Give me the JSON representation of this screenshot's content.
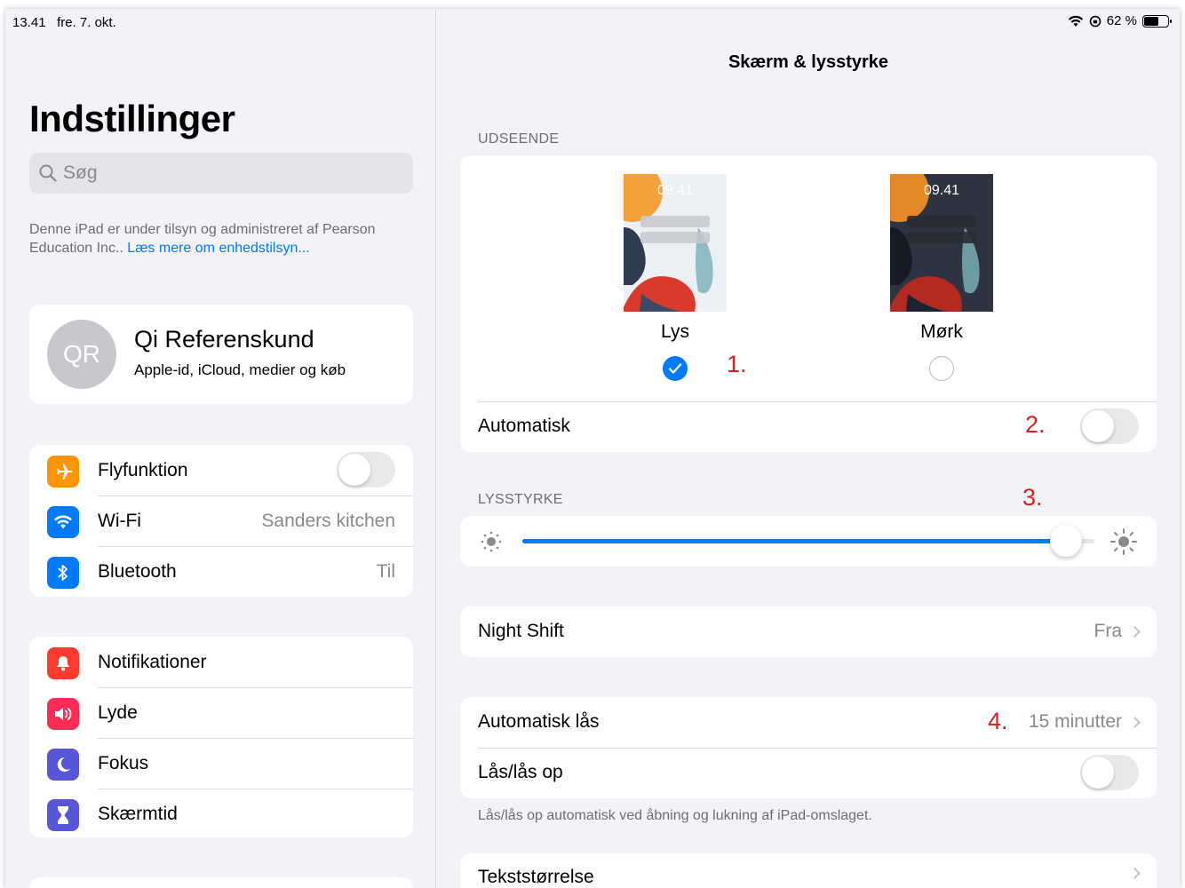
{
  "status_bar": {
    "time": "13.41",
    "date": "fre. 7. okt.",
    "battery": "62 %",
    "battery_level": 0.62
  },
  "sidebar": {
    "title": "Indstillinger",
    "search_placeholder": "Søg",
    "supervision_text": "Denne iPad er under tilsyn og administreret af Pearson Education Inc..",
    "supervision_link": "Læs mere om enhedstilsyn...",
    "profile": {
      "initials": "QR",
      "name": "Qi Referenskund",
      "subtitle": "Apple-id, iCloud, medier og køb"
    },
    "group1": [
      {
        "label": "Flyfunktion",
        "icon": "airplane-icon",
        "color": "#ff9500",
        "toggle": false
      },
      {
        "label": "Wi-Fi",
        "icon": "wifi-icon",
        "color": "#007aff",
        "value": "Sanders kitchen"
      },
      {
        "label": "Bluetooth",
        "icon": "bluetooth-icon",
        "color": "#007aff",
        "value": "Til"
      }
    ],
    "group2": [
      {
        "label": "Notifikationer",
        "icon": "bell-icon",
        "color": "#ff3b30"
      },
      {
        "label": "Lyde",
        "icon": "speaker-icon",
        "color": "#ff2d55"
      },
      {
        "label": "Fokus",
        "icon": "moon-icon",
        "color": "#5856d6"
      },
      {
        "label": "Skærmtid",
        "icon": "hourglass-icon",
        "color": "#5856d6"
      }
    ]
  },
  "main": {
    "title": "Skærm & lysstyrke",
    "appearance_header": "UDSEENDE",
    "preview_time": "09.41",
    "light_label": "Lys",
    "dark_label": "Mørk",
    "light_selected": true,
    "automatic_label": "Automatisk",
    "automatic_on": false,
    "brightness_header": "LYSSTYRKE",
    "brightness_level": 0.95,
    "night_shift_label": "Night Shift",
    "night_shift_value": "Fra",
    "auto_lock_label": "Automatisk lås",
    "auto_lock_value": "15 minutter",
    "lock_unlock_label": "Lås/lås op",
    "lock_unlock_on": false,
    "lock_unlock_footer": "Lås/lås op automatisk ved åbning og lukning af iPad-omslaget.",
    "text_size_label": "Tekststørrelse"
  },
  "annotations": [
    "1.",
    "2.",
    "3.",
    "4."
  ],
  "colors": {
    "accent": "#007aff",
    "annotation": "#e02020"
  }
}
